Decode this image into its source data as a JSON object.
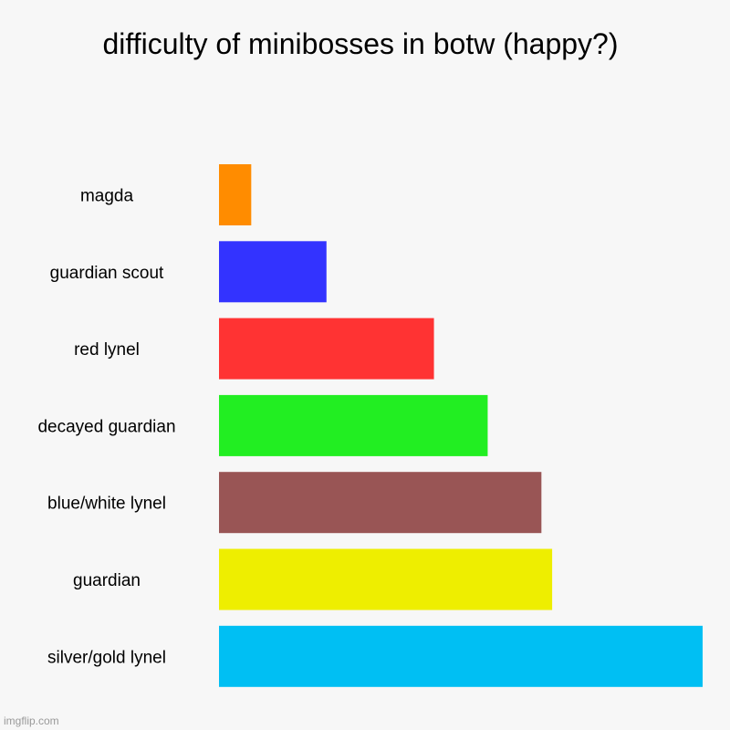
{
  "chart_data": {
    "type": "bar",
    "orientation": "horizontal",
    "title": "difficulty of minibosses in botw (happy?)",
    "categories": [
      "magda",
      "guardian scout",
      "red lynel",
      "decayed guardian",
      "blue/white lynel",
      "guardian",
      "silver/gold lynel"
    ],
    "values": [
      0.6,
      2,
      4,
      5,
      6,
      6.2,
      9
    ],
    "colors": [
      "#ff8c00",
      "#3333ff",
      "#ff3333",
      "#22ee22",
      "#995555",
      "#eeee00",
      "#00bff3"
    ],
    "xlabel": "",
    "ylabel": "",
    "xlim": [
      0,
      9
    ],
    "grid": false,
    "legend": "none"
  },
  "watermark": "imgflip.com"
}
